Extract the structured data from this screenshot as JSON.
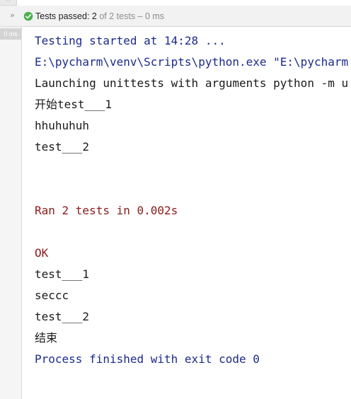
{
  "status": {
    "expand_glyph": "»",
    "check_icon": "check-circle-icon",
    "label": "Tests passed: 2",
    "detail": "of 2 tests – 0 ms"
  },
  "gutter": {
    "time": "0 ms"
  },
  "console": {
    "lines": [
      {
        "text": "Testing started at 14:28 ...",
        "kind": "sys"
      },
      {
        "text": "E:\\pycharm\\venv\\Scripts\\python.exe \"E:\\pycharm",
        "kind": "sys"
      },
      {
        "text": "Launching unittests with arguments python -m u",
        "kind": "out"
      },
      {
        "text": "开始test___1",
        "kind": "out"
      },
      {
        "text": "hhuhuhuh",
        "kind": "out"
      },
      {
        "text": "test___2",
        "kind": "out"
      },
      {
        "text": "",
        "kind": "out"
      },
      {
        "text": "",
        "kind": "out"
      },
      {
        "text": "Ran 2 tests in 0.002s",
        "kind": "err"
      },
      {
        "text": "",
        "kind": "out"
      },
      {
        "text": "OK",
        "kind": "err"
      },
      {
        "text": "test___1",
        "kind": "out"
      },
      {
        "text": "seccc",
        "kind": "out"
      },
      {
        "text": "test___2",
        "kind": "out"
      },
      {
        "text": "结束",
        "kind": "out"
      },
      {
        "text": "Process finished with exit code 0",
        "kind": "sys"
      }
    ]
  },
  "colors": {
    "system": "#1b2a8c",
    "stdout": "#1a1a1a",
    "stderr": "#8b1a1a",
    "pass": "#4caf50"
  }
}
